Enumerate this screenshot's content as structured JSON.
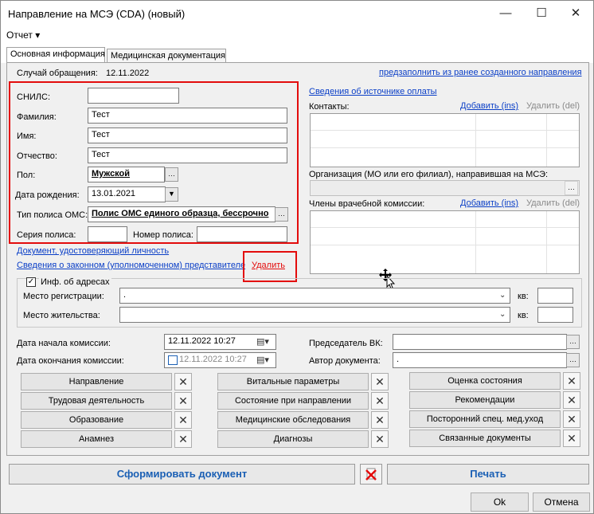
{
  "window": {
    "title": "Направление на МСЭ (CDA) (новый)",
    "minimize": "—",
    "maximize": "☐",
    "close": "✕"
  },
  "menu": {
    "report": "Отчет ▾"
  },
  "tabs": [
    {
      "label": "Основная информация",
      "active": true
    },
    {
      "label": "Медицинская документация",
      "active": false
    }
  ],
  "case": {
    "label": "Случай обращения:",
    "date": "12.11.2022"
  },
  "prefill_link": "предзаполнить из ранее созданного направления",
  "person": {
    "snils_label": "СНИЛС:",
    "snils": "",
    "lastname_label": "Фамилия:",
    "lastname": "Тест",
    "firstname_label": "Имя:",
    "firstname": "Тест",
    "patronymic_label": "Отчество:",
    "patronymic": "Тест",
    "sex_label": "Пол:",
    "sex": "Мужской",
    "birthdate_label": "Дата рождения:",
    "birthdate": "13.01.2021",
    "policy_type_label": "Тип полиса ОМС:",
    "policy_type": "Полис ОМС единого образца, бессрочно",
    "policy_series_label": "Серия полиса:",
    "policy_series": "",
    "policy_number_label": "Номер полиса:",
    "policy_number": ""
  },
  "links": {
    "identity_doc": "Документ, удостоверяющий личность",
    "representative": "Сведения о законном (уполномоченном) представителе",
    "delete": "Удалить"
  },
  "right": {
    "payment_source": "Сведения об источнике оплаты",
    "contacts_label": "Контакты:",
    "add": "Добавить (ins)",
    "remove": "Удалить (del)",
    "org_label": "Организация (МО или его филиал), направившая на МСЭ:",
    "commission_label": "Члены врачебной комиссии:"
  },
  "address": {
    "checkbox_label": "Инф. об адресах",
    "checked": true,
    "registration_label": "Место регистрации:",
    "registration": ".",
    "residence_label": "Место жительства:",
    "residence": "",
    "apt_label": "кв:"
  },
  "commission": {
    "start_label": "Дата начала комиссии:",
    "start": "12.11.2022 10:27",
    "end_label": "Дата окончания комиссии:",
    "end": "12.11.2022 10:27",
    "chair_label": "Председатель ВК:",
    "chair": "",
    "author_label": "Автор документа:",
    "author": "."
  },
  "section_buttons": {
    "col1": [
      "Направление",
      "Трудовая деятельность",
      "Образование",
      "Анамнез"
    ],
    "col2": [
      "Витальные параметры",
      "Состояние при направлении",
      "Медицинские обследования",
      "Диагнозы"
    ],
    "col3": [
      "Оценка состояния",
      "Рекомендации",
      "Посторонний спец. мед.уход",
      "Связанные документы"
    ]
  },
  "footer": {
    "generate": "Сформировать документ",
    "print": "Печать",
    "ok": "Ok",
    "cancel": "Отмена"
  },
  "colors": {
    "accent_link": "#0b3fc7",
    "highlight_red": "#e30c0c",
    "big_button_text": "#1a5fb4"
  }
}
